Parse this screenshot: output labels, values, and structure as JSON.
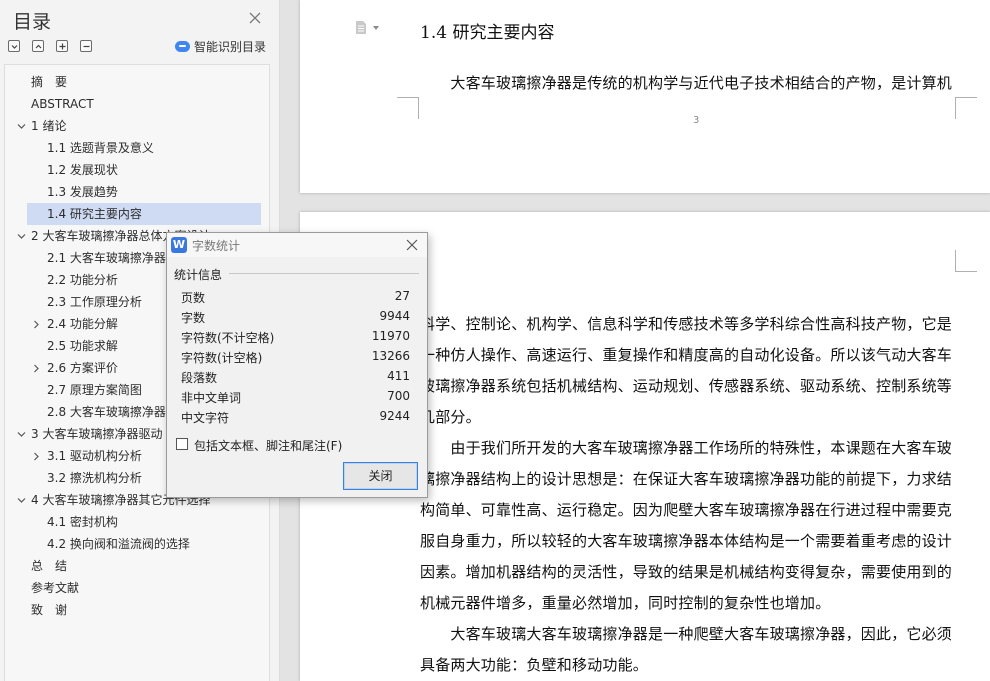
{
  "toc_panel": {
    "title": "目录",
    "smart_toc_label": "智能识别目录",
    "items": [
      {
        "label": "摘　要",
        "level": 0,
        "arrow": "",
        "active": false
      },
      {
        "label": "ABSTRACT",
        "level": 0,
        "arrow": "",
        "active": false
      },
      {
        "label": "1  绪论",
        "level": 0,
        "arrow": "down",
        "active": false
      },
      {
        "label": "1.1 选题背景及意义",
        "level": 1,
        "arrow": "",
        "active": false
      },
      {
        "label": "1.2 发展现状",
        "level": 1,
        "arrow": "",
        "active": false
      },
      {
        "label": "1.3 发展趋势",
        "level": 1,
        "arrow": "",
        "active": false
      },
      {
        "label": "1.4 研究主要内容",
        "level": 1,
        "arrow": "",
        "active": true
      },
      {
        "label": "2  大客车玻璃擦净器总体方案设计",
        "level": 0,
        "arrow": "down",
        "active": false
      },
      {
        "label": "2.1  大客车玻璃擦净器",
        "level": 1,
        "arrow": "",
        "active": false
      },
      {
        "label": "2.2 功能分析",
        "level": 1,
        "arrow": "",
        "active": false
      },
      {
        "label": "2.3 工作原理分析",
        "level": 1,
        "arrow": "",
        "active": false
      },
      {
        "label": "2.4 功能分解",
        "level": 1,
        "arrow": "right",
        "active": false
      },
      {
        "label": "2.5 功能求解",
        "level": 1,
        "arrow": "",
        "active": false
      },
      {
        "label": "2.6 方案评价",
        "level": 1,
        "arrow": "right",
        "active": false
      },
      {
        "label": "2.7 原理方案简图",
        "level": 1,
        "arrow": "",
        "active": false
      },
      {
        "label": "2.8  大客车玻璃擦净器",
        "level": 1,
        "arrow": "",
        "active": false
      },
      {
        "label": "3  大客车玻璃擦净器驱动",
        "level": 0,
        "arrow": "down",
        "active": false
      },
      {
        "label": "3.1  驱动机构分析",
        "level": 1,
        "arrow": "right",
        "active": false
      },
      {
        "label": "3.2 擦洗机构分析",
        "level": 1,
        "arrow": "",
        "active": false
      },
      {
        "label": "4  大客车玻璃擦净器其它元件选择",
        "level": 0,
        "arrow": "down",
        "active": false
      },
      {
        "label": "4.1 密封机构",
        "level": 1,
        "arrow": "",
        "active": false
      },
      {
        "label": "4.2 换向阀和溢流阀的选择",
        "level": 1,
        "arrow": "",
        "active": false
      },
      {
        "label": "总　结",
        "level": 0,
        "arrow": "",
        "active": false
      },
      {
        "label": "参考文献",
        "level": 0,
        "arrow": "",
        "active": false
      },
      {
        "label": "致　谢",
        "level": 0,
        "arrow": "",
        "active": false
      }
    ]
  },
  "document": {
    "section_heading": "1.4 研究主要内容",
    "page_number": "3",
    "top_lines": [
      "　　大客车玻璃擦净器是传统的机构学与近代电子技术相结合的产物，是计算机"
    ],
    "bottom_lines": [
      "科学、控制论、机构学、信息科学和传感技术等多学科综合性高科技产物，它是",
      "一种仿人操作、高速运行、重复操作和精度高的自动化设备。所以该气动大客车",
      "玻璃擦净器系统包括机械结构、运动规划、传感器系统、驱动系统、控制系统等",
      "几部分。",
      "　　由于我们所开发的大客车玻璃擦净器工作场所的特殊性，本课题在大客车玻",
      "璃擦净器结构上的设计思想是：在保证大客车玻璃擦净器功能的前提下，力求结",
      "构简单、可靠性高、运行稳定。因为爬壁大客车玻璃擦净器在行进过程中需要克",
      "服自身重力，所以较轻的大客车玻璃擦净器本体结构是一个需要着重考虑的设计",
      "因素。增加机器结构的灵活性，导致的结果是机械结构变得复杂，需要使用到的",
      "机械元器件增多，重量必然增加，同时控制的复杂性也增加。",
      "　　大客车玻璃大客车玻璃擦净器是一种爬壁大客车玻璃擦净器，因此，它必须",
      "具备两大功能：负壁和移动功能。"
    ]
  },
  "dialog": {
    "title": "字数统计",
    "logo_text": "W",
    "group_label": "统计信息",
    "stats": [
      {
        "label": "页数",
        "value": "27"
      },
      {
        "label": "字数",
        "value": "9944"
      },
      {
        "label": "字符数(不计空格)",
        "value": "11970"
      },
      {
        "label": "字符数(计空格)",
        "value": "13266"
      },
      {
        "label": "段落数",
        "value": "411"
      },
      {
        "label": "非中文单词",
        "value": "700"
      },
      {
        "label": "中文字符",
        "value": "9244"
      }
    ],
    "checkbox_label": "包括文本框、脚注和尾注(F)",
    "checkbox_checked": false,
    "close_button": "关闭"
  },
  "colors": {
    "active_toc_bg": "#cfdaf3",
    "accent": "#3a78e0",
    "panel_bg": "#f3f3f3"
  },
  "icons": [
    "close-icon",
    "collapse-all-icon",
    "expand-icon",
    "add-level-icon",
    "remove-level-icon",
    "smart-cloud-icon",
    "document-icon",
    "chevron-down-icon",
    "chevron-right-icon",
    "wps-logo-icon"
  ]
}
